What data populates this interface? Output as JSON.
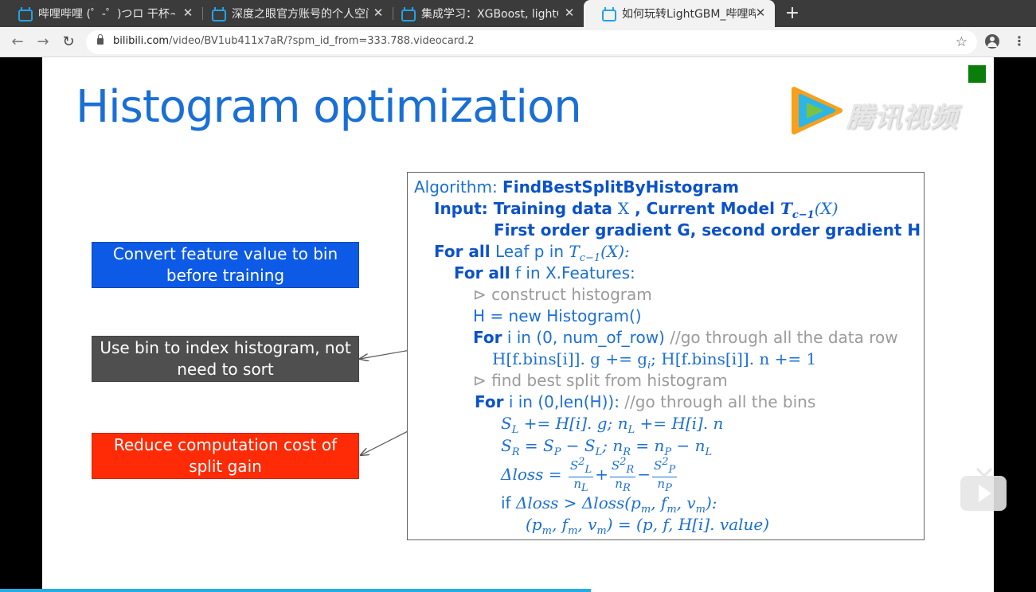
{
  "browser": {
    "tabs": [
      {
        "title": "哔哩哔哩 (゜-゜)つロ 干杯~",
        "active": false
      },
      {
        "title": "深度之眼官方账号的个人空间",
        "active": false
      },
      {
        "title": "集成学习：XGBoost, lightGBM",
        "active": false
      },
      {
        "title": "如何玩转LightGBM_哔哩哔哩",
        "active": true
      }
    ],
    "close_glyph": "✕",
    "new_tab_glyph": "+",
    "url_host": "bilibili.com",
    "url_path": "/video/BV1ub411x7aR/?spm_id_from=333.788.videocard.2",
    "icons": {
      "back": "←",
      "forward": "→",
      "reload": "↻",
      "bookmark": "☆",
      "menu": "⋮"
    }
  },
  "slide": {
    "title": "Histogram optimization",
    "watermark_text": "腾讯视频",
    "boxes": [
      {
        "text1": "Convert feature value to bin",
        "text2": "before training",
        "color": "#0c5ae6"
      },
      {
        "text1": "Use bin to index histogram, not",
        "text2": "need to sort",
        "color": "#4f4f4f"
      },
      {
        "text1": "Reduce computation cost of",
        "text2": "split gain",
        "color": "#ff2b06"
      }
    ],
    "algorithm": {
      "l1_label": "Algorithm: ",
      "l1_name": "FindBestSplitByHistogram",
      "l2_label": "Input: Training data ",
      "l2_x": "X",
      "l2_mid": " , Current Model ",
      "l2_model": "T",
      "l2_sub": "c−1",
      "l2_arg": "(X)",
      "l3": "First order gradient G, second order gradient H",
      "l4_kw": "For all",
      "l4_text": " Leaf p in ",
      "l4_t": "T",
      "l4_sub": "c−1",
      "l4_arg": "(X):",
      "l5_kw": "For all",
      "l5_text": " f in X.Features:",
      "l6": "⊳ construct histogram",
      "l7": "H = new Histogram()",
      "l8_kw": "For",
      "l8_text": " i in (0, num_of_row)",
      "l8_comment": "  //go through all the data row",
      "l9": "H[f.bins[i]]. g += g",
      "l9_sub": "i",
      "l9_rest": "; H[f.bins[i]]. n += 1",
      "l10": "⊳ find best split from histogram",
      "l11_kw": "For",
      "l11_text": " i in (0,len(H)): ",
      "l11_comment": "//go through all the bins",
      "l12": "S",
      "l12_sub1": "L",
      "l12_a": " += H[i]. g; n",
      "l12_sub2": "L",
      "l12_b": " += H[i]. n",
      "l13": "S",
      "l13_sub1": "R",
      "l13_a": " = S",
      "l13_sub2": "P",
      "l13_b": " − S",
      "l13_sub3": "L",
      "l13_c": "; n",
      "l13_sub4": "R",
      "l13_d": " = n",
      "l13_sub5": "P",
      "l13_e": " − n",
      "l13_sub6": "L",
      "l14_lhs": "Δloss = ",
      "l14_f1_num": "S",
      "l14_f1_sub": "L",
      "l14_f1_den": "n",
      "l14_f1_dsub": "L",
      "l14_f2_num": "S",
      "l14_f2_sub": "R",
      "l14_f2_den": "n",
      "l14_f2_dsub": "R",
      "l14_f3_num": "S",
      "l14_f3_sub": "P",
      "l14_f3_den": "n",
      "l14_f3_dsub": "P",
      "l14_plus": "+",
      "l14_minus": "−",
      "sup2": "2",
      "l15_if": "if ",
      "l15": "Δloss > Δloss(p",
      "l15_s1": "m",
      "l15_a": ", f",
      "l15_s2": "m",
      "l15_b": ", v",
      "l15_s3": "m",
      "l15_c": "):",
      "l16": "(p",
      "l16_s1": "m",
      "l16_a": ", f",
      "l16_s2": "m",
      "l16_b": ", v",
      "l16_s3": "m",
      "l16_c": ") = (p, f, H[i]. value)"
    }
  },
  "player": {
    "progress_fraction": 0.57
  }
}
